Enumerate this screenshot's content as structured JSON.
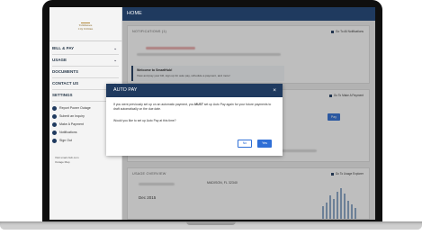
{
  "header": {
    "title": "HOME"
  },
  "logo": {
    "line1": "Tallahassee",
    "line2": "City Utilities"
  },
  "sidebar": {
    "items": [
      {
        "label": "BILL & PAY",
        "chevron": true
      },
      {
        "label": "USAGE",
        "chevron": true
      },
      {
        "label": "DOCUMENTS",
        "chevron": false
      },
      {
        "label": "CONTACT US",
        "chevron": true
      },
      {
        "label": "SETTINGS",
        "chevron": true
      }
    ],
    "quick_links": [
      {
        "label": "Report Power Outage"
      },
      {
        "label": "Submit an Inquiry"
      },
      {
        "label": "Make A Payment"
      },
      {
        "label": "Notifications"
      },
      {
        "label": "Sign Out"
      }
    ],
    "footer": [
      "Visit smart-hub.com",
      "Outage Map"
    ],
    "colors": {
      "accent": "#1f3a5f"
    }
  },
  "notifications": {
    "heading": "NOTIFICATIONS (1)",
    "link": "Go To All Notifications",
    "welcome_title": "Welcome to SmartHub!",
    "welcome_text": "View and pay your bill, sign up for auto pay, schedule a payment, and more!"
  },
  "customer": {
    "heading": "CUSTOMER",
    "link": "Go To Make A Payment",
    "amount_symbol": "$",
    "pay_label": "Pay"
  },
  "usage": {
    "heading": "USAGE OVERVIEW",
    "link": "Go To Usage Explorer",
    "address": "MADISON, FL 32340",
    "period": "Dec 2015"
  },
  "modal": {
    "title": "AUTO PAY",
    "close": "×",
    "body_pre": "If you were previously set up on an automatic payment, you ",
    "body_emph": "MUST",
    "body_post": " set up Auto Pay again for your future payments to draft automatically on the due date.",
    "question": "Would you like to set up Auto Pay at this time?",
    "no_label": "No",
    "yes_label": "Yes",
    "button_color": "#2f6fd6"
  }
}
